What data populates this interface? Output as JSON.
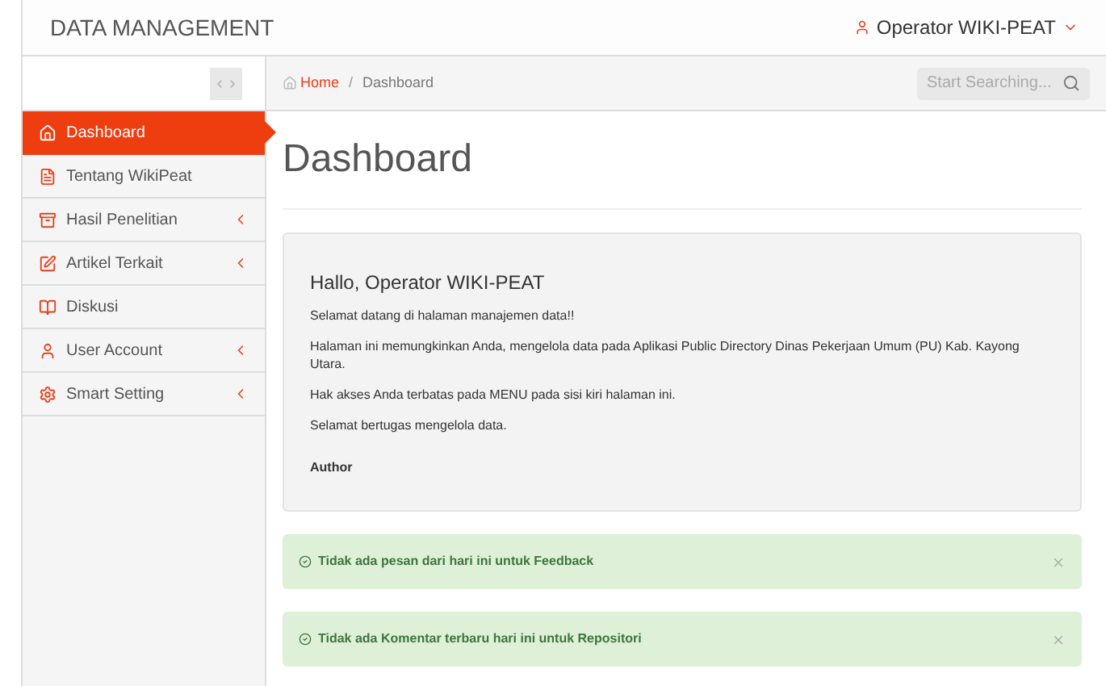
{
  "header": {
    "title": "DATA MANAGEMENT",
    "user": "Operator WIKI-PEAT"
  },
  "breadcrumb_separator": "/",
  "breadcrumb": [
    {
      "label": "Home",
      "kind": "link"
    },
    {
      "label": "Dashboard",
      "kind": "current"
    }
  ],
  "search": {
    "placeholder": "Start Searching..."
  },
  "sidebar": {
    "items": [
      {
        "label": "Dashboard",
        "selected": true,
        "submenu": false
      },
      {
        "label": "Tentang WikiPeat",
        "selected": false,
        "submenu": false
      },
      {
        "label": "Hasil Penelitian",
        "selected": false,
        "submenu": true
      },
      {
        "label": "Artikel Terkait",
        "selected": false,
        "submenu": true
      },
      {
        "label": "Diskusi",
        "selected": false,
        "submenu": false
      },
      {
        "label": "User Account",
        "selected": false,
        "submenu": true
      },
      {
        "label": "Smart Setting",
        "selected": false,
        "submenu": true
      }
    ]
  },
  "page_title": "Dashboard",
  "welcome": {
    "heading": "Hallo, Operator WIKI-PEAT",
    "paragraphs": [
      "Selamat datang di halaman manajemen data!!",
      "Halaman ini memungkinkan Anda, mengelola data pada Aplikasi Public Directory Dinas Pekerjaan Umum (PU) Kab. Kayong Utara.",
      "Hak akses Anda terbatas pada MENU pada sisi kiri halaman ini.",
      "Selamat bertugas mengelola data."
    ],
    "author": "Author"
  },
  "alerts": [
    {
      "text": "Tidak ada pesan dari hari ini untuk Feedback"
    },
    {
      "text": "Tidak ada Komentar terbaru hari ini untuk Repositori"
    }
  ]
}
